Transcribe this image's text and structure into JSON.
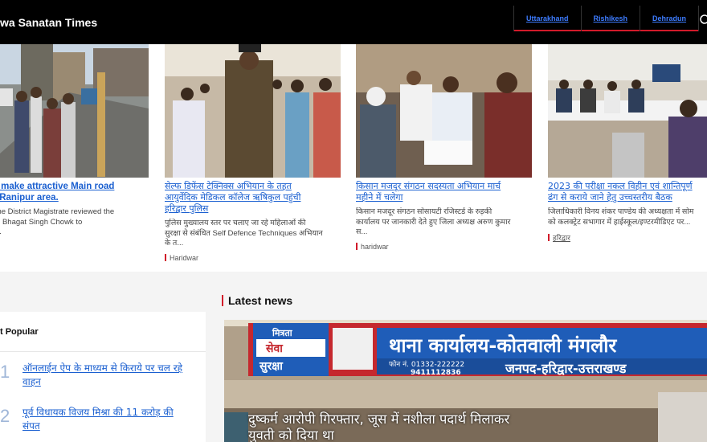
{
  "header": {
    "site_title": "wa Sanatan Times",
    "nav": [
      "Uttarakhand",
      "Rishikesh",
      "Dehradun"
    ]
  },
  "featured": [
    {
      "title_lines": [
        "der to make attractive Main road",
        "idwar Ranipur area."
      ],
      "desc_lines": [
        "rsday, the District Magistrate reviewed the",
        "ing from Bhagat Singh Chowk to",
        "achary..."
      ],
      "category": "war"
    },
    {
      "title_lines": [
        "सेल्फ डिफेंस टेक्निक्स अभियान के तहत",
        "आयुर्वेदिक मेडिकल कॉलेज ऋषिकुल पहुंची",
        "हरिद्वार पुलिस"
      ],
      "desc_lines": [
        "पुलिस मुख्यालय स्तर पर चलाए जा रहे महिलाओं की",
        "सुरक्षा से संबंधित Self Defence Techniques अभियान",
        "के त..."
      ],
      "category": "Haridwar"
    },
    {
      "title_lines": [
        "किसान मजदूर संगठन सदस्यता अभियान मार्च",
        "महीने में चलेगा"
      ],
      "desc_lines": [
        "किसान मजदूर संगठन सोसायटी रजिस्टर्ड के रुड़की",
        "कार्यालय पर जानकारी देते हुए जिला अध्यक्ष अरुण कुमार",
        "स..."
      ],
      "category": "haridwar"
    },
    {
      "title_lines": [
        "2023 की परीक्षा नकल विहीन एवं शान्तिपूर्ण",
        "ढंग से कराये जाने हेतु उच्चस्तरीय बैठक"
      ],
      "desc_lines": [
        "जिलाधिकारी विनय शंकर पाण्डेय की अध्यक्षता में सोम",
        "को कलक्ट्रेट सभागार में हाईस्कूल/इण्टरमीडिएट पर..."
      ],
      "category": "हरिद्वार"
    }
  ],
  "popular": {
    "heading": "t Popular",
    "items": [
      {
        "num": "1",
        "title_lines": [
          "ऑनलाईन ऐप के माध्यम से किराये पर चल रहे",
          "वाहन"
        ]
      },
      {
        "num": "2",
        "title_lines": [
          "पूर्व विधायक विजय मिश्रा की 11 करोड़ की",
          "संपत"
        ]
      }
    ]
  },
  "latest": {
    "heading": "Latest news",
    "hero_sign": {
      "left_box": [
        "मित्रता",
        "सेवा",
        "सुरक्षा"
      ],
      "main": "थाना कार्यालय-कोतवाली मंगलौर",
      "phone": "फोन नं. 01332-222222",
      "mobile": "9411112836",
      "district": "जनपद-हरिद्वार-उत्तराखण्ड"
    },
    "hero_title_lines": [
      "दुष्कर्म आरोपी गिरफ्तार, जूस में नशीला पदार्थ मिलाकर",
      "युवती को दिया था"
    ]
  },
  "colors": {
    "accent": "#d11a2a",
    "link": "#1a5fd0",
    "nav_link": "#3d7cff"
  }
}
